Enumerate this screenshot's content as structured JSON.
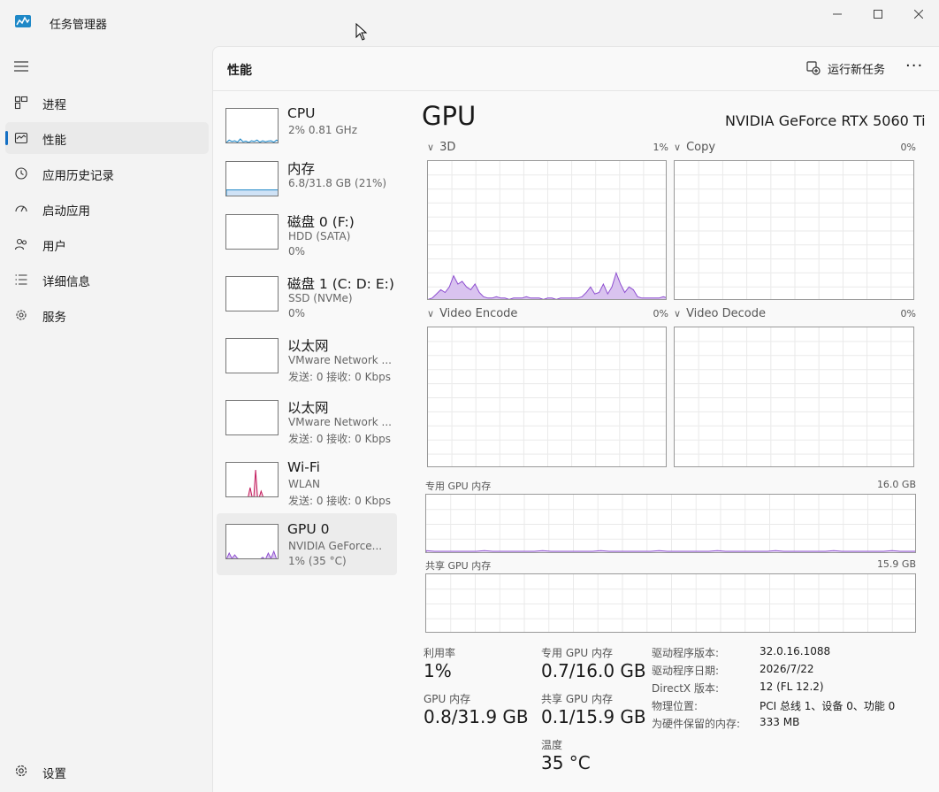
{
  "app": {
    "title": "任务管理器"
  },
  "nav": {
    "items": [
      {
        "label": "进程",
        "icon": "processes-icon"
      },
      {
        "label": "性能",
        "icon": "performance-icon",
        "active": true
      },
      {
        "label": "应用历史记录",
        "icon": "app-history-icon"
      },
      {
        "label": "启动应用",
        "icon": "startup-apps-icon"
      },
      {
        "label": "用户",
        "icon": "users-icon"
      },
      {
        "label": "详细信息",
        "icon": "details-icon"
      },
      {
        "label": "服务",
        "icon": "services-icon"
      }
    ],
    "settings_label": "设置"
  },
  "header": {
    "title": "性能",
    "run_task": "运行新任务"
  },
  "devices": [
    {
      "name": "CPU",
      "sub1": "2% 0.81 GHz",
      "sub2": ""
    },
    {
      "name": "内存",
      "sub1": "6.8/31.8 GB (21%)",
      "sub2": ""
    },
    {
      "name": "磁盘 0 (F:)",
      "sub1": "HDD (SATA)",
      "sub2": "0%"
    },
    {
      "name": "磁盘 1 (C: D: E:)",
      "sub1": "SSD (NVMe)",
      "sub2": "0%"
    },
    {
      "name": "以太网",
      "sub1": "VMware Network ...",
      "sub2": "发送: 0 接收: 0 Kbps"
    },
    {
      "name": "以太网",
      "sub1": "VMware Network ...",
      "sub2": "发送: 0 接收: 0 Kbps"
    },
    {
      "name": "Wi-Fi",
      "sub1": "WLAN",
      "sub2": "发送: 0 接收: 0 Kbps"
    },
    {
      "name": "GPU 0",
      "sub1": "NVIDIA GeForce...",
      "sub2": "1% (35 °C)",
      "selected": true
    }
  ],
  "gpu": {
    "title": "GPU",
    "model": "NVIDIA GeForce RTX 5060 Ti",
    "engines": [
      {
        "label": "3D",
        "pct": "1%"
      },
      {
        "label": "Copy",
        "pct": "0%"
      },
      {
        "label": "Video Encode",
        "pct": "0%"
      },
      {
        "label": "Video Decode",
        "pct": "0%"
      }
    ],
    "dedicated_mem": {
      "label": "专用 GPU 内存",
      "cap": "16.0 GB"
    },
    "shared_mem": {
      "label": "共享 GPU 内存",
      "cap": "15.9 GB"
    },
    "stats": {
      "util_label": "利用率",
      "util_value": "1%",
      "gpu_mem_label": "GPU 内存",
      "gpu_mem_value": "0.8/31.9 GB",
      "ded_label": "专用 GPU 内存",
      "ded_value": "0.7/16.0 GB",
      "shared_label": "共享 GPU 内存",
      "shared_value": "0.1/15.9 GB",
      "temp_label": "温度",
      "temp_value": "35 °C"
    },
    "info": [
      {
        "k": "驱动程序版本:",
        "v": "32.0.16.1088"
      },
      {
        "k": "驱动程序日期:",
        "v": "2026/7/22"
      },
      {
        "k": "DirectX 版本:",
        "v": "12 (FL 12.2)"
      },
      {
        "k": "物理位置:",
        "v": "PCI 总线 1、设备 0、功能 0"
      },
      {
        "k": "为硬件保留的内存:",
        "v": "333 MB"
      }
    ]
  },
  "colors": {
    "gpu_line": "#8e4fd0",
    "gpu_fill": "#d9c3ef",
    "mem_line": "#8e4fd0",
    "net_line": "#c2185b",
    "cpu_line": "#1e88c7",
    "mem_fill": "#cfe2f6",
    "accent": "#1570c4"
  }
}
